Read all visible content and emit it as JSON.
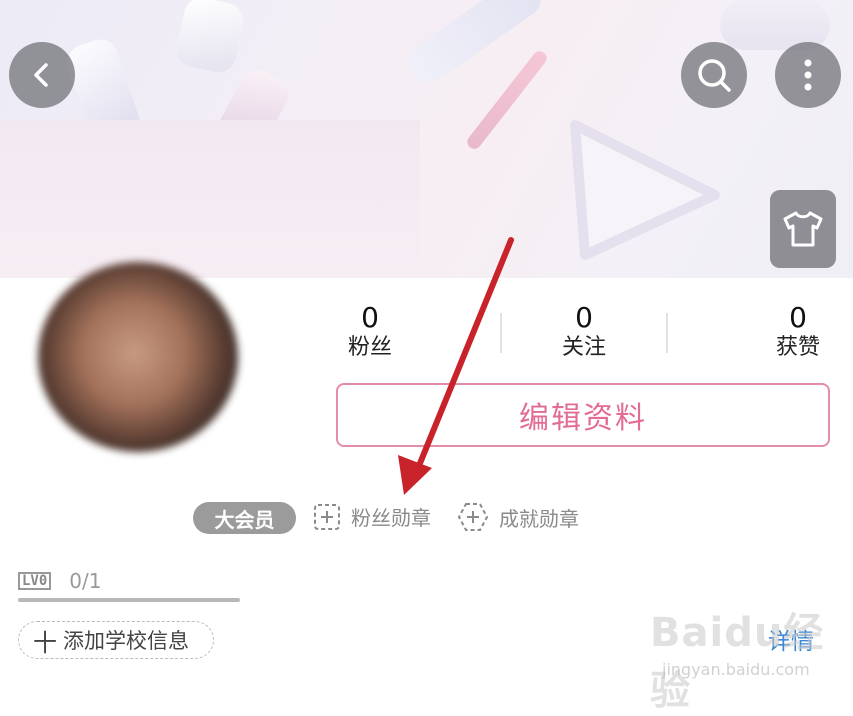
{
  "header": {
    "back_icon": "chevron-left-icon",
    "search_icon": "search-icon",
    "more_icon": "more-vertical-icon",
    "skin_icon": "tshirt-icon"
  },
  "stats": [
    {
      "value": "0",
      "label": "粉丝"
    },
    {
      "value": "0",
      "label": "关注"
    },
    {
      "value": "0",
      "label": "获赞"
    }
  ],
  "edit_profile_label": "编辑资料",
  "badges": {
    "vip_label": "大会员",
    "fan_badge_label": "粉丝勋章",
    "achievement_badge_label": "成就勋章"
  },
  "level": {
    "tag": "LV0",
    "exp": "0/1",
    "progress": 0
  },
  "school_button_label": "添加学校信息",
  "school_plus_glyph": "十",
  "detail_link_label": "详情",
  "watermark": {
    "main": "Baidu经验",
    "sub": "jingyan.baidu.com"
  },
  "colors": {
    "accent_pink": "#e36c92",
    "annotation_red": "#c8222a",
    "link_blue": "#3b86d6"
  }
}
